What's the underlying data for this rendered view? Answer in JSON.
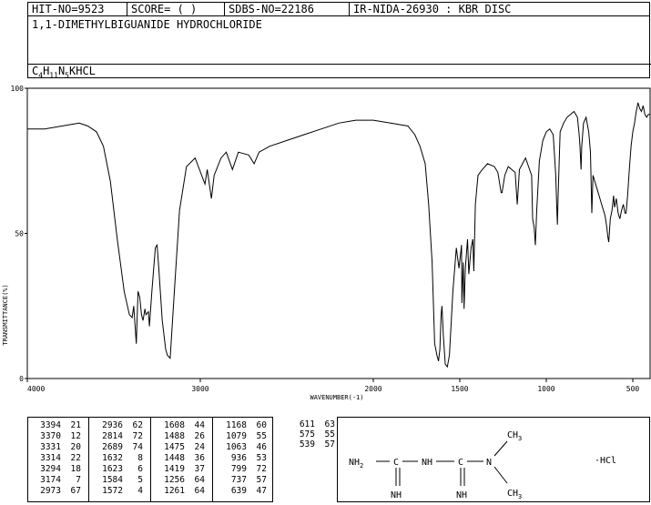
{
  "header": {
    "hit_no": "HIT-NO=9523",
    "score": "SCORE=  (   )",
    "sdbs_no": "SDBS-NO=22186",
    "ir_code": "IR-NIDA-26930 : KBR DISC"
  },
  "compound": {
    "name": "1,1-DIMETHYLBIGUANIDE HYDROCHLORIDE",
    "formula_parts": [
      "C",
      "4",
      "H",
      "11",
      "N",
      "5",
      "",
      "",
      "K",
      "",
      "HCL",
      ""
    ]
  },
  "chart_data": {
    "type": "line",
    "title": "",
    "xlabel": "WAVENUMBER(-1)",
    "ylabel": "TRANSMITTANCE(%)",
    "xlim": [
      4000,
      400
    ],
    "ylim": [
      0,
      100
    ],
    "x_ticks": [
      "4000",
      "3000",
      "2000",
      "1500",
      "1000",
      "500"
    ],
    "y_ticks": [
      "100",
      "50",
      "0"
    ],
    "series": [
      {
        "color": "#000000",
        "points": [
          [
            4000,
            86
          ],
          [
            3900,
            86
          ],
          [
            3800,
            87
          ],
          [
            3700,
            88
          ],
          [
            3650,
            87
          ],
          [
            3600,
            85
          ],
          [
            3560,
            80
          ],
          [
            3520,
            68
          ],
          [
            3480,
            48
          ],
          [
            3440,
            30
          ],
          [
            3410,
            22
          ],
          [
            3394,
            21
          ],
          [
            3385,
            25
          ],
          [
            3370,
            12
          ],
          [
            3360,
            30
          ],
          [
            3350,
            28
          ],
          [
            3340,
            22
          ],
          [
            3331,
            20
          ],
          [
            3320,
            24
          ],
          [
            3314,
            22
          ],
          [
            3300,
            23
          ],
          [
            3294,
            18
          ],
          [
            3280,
            30
          ],
          [
            3260,
            45
          ],
          [
            3250,
            46
          ],
          [
            3240,
            38
          ],
          [
            3220,
            20
          ],
          [
            3200,
            10
          ],
          [
            3190,
            8
          ],
          [
            3174,
            7
          ],
          [
            3150,
            30
          ],
          [
            3120,
            58
          ],
          [
            3080,
            73
          ],
          [
            3030,
            76
          ],
          [
            2973,
            67
          ],
          [
            2960,
            72
          ],
          [
            2936,
            62
          ],
          [
            2920,
            70
          ],
          [
            2880,
            76
          ],
          [
            2850,
            78
          ],
          [
            2814,
            72
          ],
          [
            2780,
            78
          ],
          [
            2720,
            77
          ],
          [
            2689,
            74
          ],
          [
            2660,
            78
          ],
          [
            2600,
            80
          ],
          [
            2500,
            82
          ],
          [
            2400,
            84
          ],
          [
            2300,
            86
          ],
          [
            2200,
            88
          ],
          [
            2100,
            89
          ],
          [
            2000,
            89
          ],
          [
            1900,
            88
          ],
          [
            1800,
            87
          ],
          [
            1760,
            84
          ],
          [
            1730,
            80
          ],
          [
            1700,
            74
          ],
          [
            1680,
            60
          ],
          [
            1660,
            40
          ],
          [
            1645,
            12
          ],
          [
            1632,
            8
          ],
          [
            1623,
            6
          ],
          [
            1615,
            10
          ],
          [
            1608,
            22
          ],
          [
            1603,
            25
          ],
          [
            1595,
            15
          ],
          [
            1584,
            5
          ],
          [
            1572,
            4
          ],
          [
            1560,
            8
          ],
          [
            1540,
            30
          ],
          [
            1520,
            45
          ],
          [
            1505,
            38
          ],
          [
            1490,
            46
          ],
          [
            1488,
            26
          ],
          [
            1480,
            40
          ],
          [
            1475,
            24
          ],
          [
            1468,
            38
          ],
          [
            1455,
            48
          ],
          [
            1448,
            36
          ],
          [
            1435,
            45
          ],
          [
            1425,
            48
          ],
          [
            1419,
            37
          ],
          [
            1410,
            60
          ],
          [
            1395,
            70
          ],
          [
            1370,
            72
          ],
          [
            1340,
            74
          ],
          [
            1300,
            73
          ],
          [
            1280,
            71
          ],
          [
            1261,
            64
          ],
          [
            1256,
            64
          ],
          [
            1240,
            70
          ],
          [
            1220,
            73
          ],
          [
            1200,
            72
          ],
          [
            1180,
            71
          ],
          [
            1168,
            60
          ],
          [
            1155,
            72
          ],
          [
            1120,
            76
          ],
          [
            1085,
            70
          ],
          [
            1079,
            55
          ],
          [
            1070,
            52
          ],
          [
            1063,
            46
          ],
          [
            1055,
            58
          ],
          [
            1040,
            75
          ],
          [
            1020,
            82
          ],
          [
            1000,
            85
          ],
          [
            980,
            86
          ],
          [
            960,
            84
          ],
          [
            945,
            70
          ],
          [
            940,
            60
          ],
          [
            936,
            53
          ],
          [
            932,
            62
          ],
          [
            920,
            85
          ],
          [
            900,
            88
          ],
          [
            880,
            90
          ],
          [
            860,
            91
          ],
          [
            840,
            92
          ],
          [
            820,
            90
          ],
          [
            810,
            84
          ],
          [
            805,
            80
          ],
          [
            799,
            72
          ],
          [
            795,
            80
          ],
          [
            785,
            88
          ],
          [
            770,
            90
          ],
          [
            755,
            85
          ],
          [
            745,
            78
          ],
          [
            737,
            57
          ],
          [
            730,
            70
          ],
          [
            720,
            68
          ],
          [
            700,
            64
          ],
          [
            680,
            60
          ],
          [
            660,
            56
          ],
          [
            650,
            52
          ],
          [
            645,
            49
          ],
          [
            639,
            47
          ],
          [
            630,
            55
          ],
          [
            620,
            58
          ],
          [
            611,
            63
          ],
          [
            605,
            59
          ],
          [
            595,
            62
          ],
          [
            585,
            57
          ],
          [
            575,
            55
          ],
          [
            565,
            58
          ],
          [
            555,
            60
          ],
          [
            545,
            57
          ],
          [
            539,
            57
          ],
          [
            530,
            63
          ],
          [
            520,
            72
          ],
          [
            510,
            80
          ],
          [
            500,
            85
          ],
          [
            490,
            88
          ],
          [
            480,
            92
          ],
          [
            470,
            95
          ],
          [
            460,
            93
          ],
          [
            450,
            92
          ],
          [
            440,
            94
          ],
          [
            430,
            91
          ],
          [
            420,
            90
          ],
          [
            410,
            91
          ],
          [
            400,
            91
          ]
        ]
      }
    ]
  },
  "peak_table": {
    "columns": [
      [
        [
          "3394",
          "21"
        ],
        [
          "3370",
          "12"
        ],
        [
          "3331",
          "20"
        ],
        [
          "3314",
          "22"
        ],
        [
          "3294",
          "18"
        ],
        [
          "3174",
          "7"
        ],
        [
          "2973",
          "67"
        ]
      ],
      [
        [
          "2936",
          "62"
        ],
        [
          "2814",
          "72"
        ],
        [
          "2689",
          "74"
        ],
        [
          "1632",
          "8"
        ],
        [
          "1623",
          "6"
        ],
        [
          "1584",
          "5"
        ],
        [
          "1572",
          "4"
        ]
      ],
      [
        [
          "1608",
          "44"
        ],
        [
          "1488",
          "26"
        ],
        [
          "1475",
          "24"
        ],
        [
          "1448",
          "36"
        ],
        [
          "1419",
          "37"
        ],
        [
          "1256",
          "64"
        ],
        [
          "1261",
          "64"
        ]
      ],
      [
        [
          "1168",
          "60"
        ],
        [
          "1079",
          "55"
        ],
        [
          "1063",
          "46"
        ],
        [
          "936",
          "53"
        ],
        [
          "799",
          "72"
        ],
        [
          "737",
          "57"
        ],
        [
          "639",
          "47"
        ]
      ],
      [
        [
          "611",
          "63"
        ],
        [
          "575",
          "55"
        ],
        [
          "539",
          "57"
        ]
      ]
    ]
  },
  "structure": {
    "left_group": "NH2",
    "c1": "C",
    "nh_mid": "NH",
    "c2": "C",
    "n_right": "N",
    "ch3_top": "CH3",
    "ch3_bottom": "CH3",
    "imine1": "NH",
    "imine2": "NH",
    "salt": "·HCl"
  }
}
